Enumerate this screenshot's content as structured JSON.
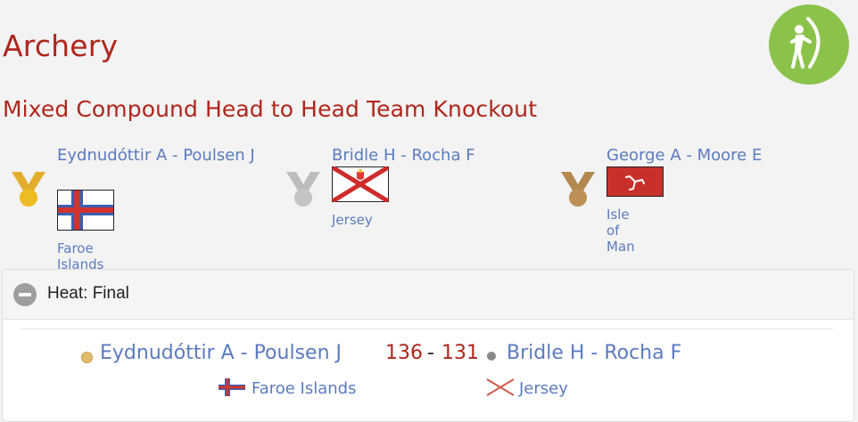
{
  "page": {
    "title": "Archery",
    "event": "Mixed Compound Head to Head Team Knockout"
  },
  "sport_icon": "archery-icon",
  "colors": {
    "heading": "#b0261c",
    "link": "#5b7bc0",
    "badge": "#8bc34a",
    "gold": "#e8b923",
    "silver": "#bdbdbd",
    "bronze": "#b58a4e"
  },
  "podium": [
    {
      "medal": "gold",
      "names": "Eydnudóttir A - Poulsen J",
      "country": "Faroe Islands",
      "flag": "faroe-islands-flag"
    },
    {
      "medal": "silver",
      "names": "Bridle H - Rocha F",
      "country": "Jersey",
      "flag": "jersey-flag"
    },
    {
      "medal": "bronze",
      "names": "George A - Moore E",
      "country": "Isle of Man",
      "flag": "isle-of-man-flag"
    }
  ],
  "heat": {
    "label": "Heat: Final",
    "collapse_icon": "minus-circle-icon",
    "match": {
      "team1": {
        "names": "Eydnudóttir A - Poulsen J",
        "score": "136",
        "country": "Faroe Islands",
        "medal": "gold"
      },
      "separator": "-",
      "team2": {
        "names": "Bridle H - Rocha F",
        "score": "131",
        "country": "Jersey",
        "medal": "silver"
      }
    }
  }
}
